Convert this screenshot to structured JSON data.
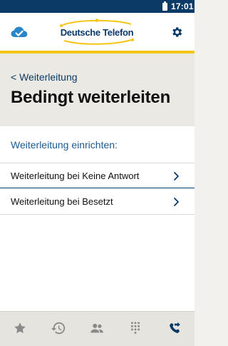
{
  "status_bar": {
    "time": "17:01"
  },
  "header": {
    "brand": "Deutsche Telefon"
  },
  "page": {
    "back_label": "< Weiterleitung",
    "title": "Bedingt weiterleiten"
  },
  "section": {
    "label": "Weiterleitung einrichten:",
    "items": [
      {
        "label": "Weiterleitung bei Keine Antwort"
      },
      {
        "label": "Weiterleitung bei Besetzt"
      }
    ]
  },
  "tabbar": {
    "tabs": [
      {
        "icon": "star-icon"
      },
      {
        "icon": "history-icon"
      },
      {
        "icon": "contacts-icon"
      },
      {
        "icon": "dialpad-icon"
      },
      {
        "icon": "call-forward-icon"
      }
    ]
  },
  "colors": {
    "primary": "#0b3a67",
    "accent": "#f5c518",
    "link": "#1d5b8f",
    "icon_cloud": "#2a86c7"
  }
}
